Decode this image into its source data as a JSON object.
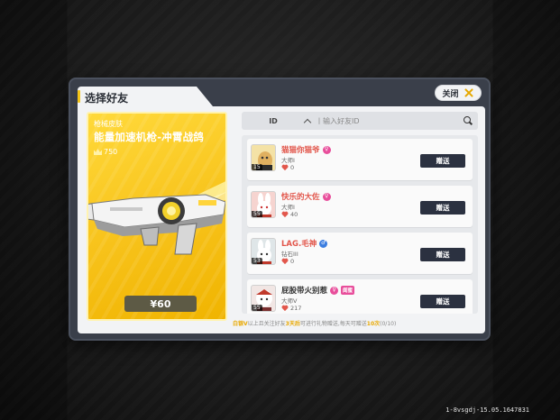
{
  "dialog": {
    "title": "选择好友",
    "close_label": "关闭"
  },
  "product": {
    "category": "枪械皮肤",
    "name": "能量加速机枪-冲霄战鸽",
    "points": "750",
    "price": "¥60"
  },
  "search": {
    "id_label": "ID",
    "placeholder": "丨输入好友ID"
  },
  "friends": [
    {
      "name": "猫猫你猫爷",
      "gender": "female",
      "gender_symbol": "♀",
      "rank": "大师I",
      "likes": "0",
      "level": "15",
      "tag": "",
      "gift_label": "赠送",
      "avatar_bg": "#f4e2a6"
    },
    {
      "name": "快乐的大佐",
      "gender": "female",
      "gender_symbol": "♀",
      "rank": "大师I",
      "likes": "40",
      "level": "55",
      "tag": "",
      "gift_label": "赠送",
      "avatar_bg": "#f6d4d0"
    },
    {
      "name": "LAG.毛神",
      "gender": "male",
      "gender_symbol": "♂",
      "rank": "钻石III",
      "likes": "0",
      "level": "53",
      "tag": "",
      "gift_label": "赠送",
      "avatar_bg": "#dfe6e8"
    },
    {
      "name": "屁股带火别惹",
      "gender": "female",
      "gender_symbol": "♀",
      "rank": "大师V",
      "likes": "217",
      "level": "55",
      "tag": "闺蜜",
      "gift_label": "赠送",
      "avatar_bg": "#f1e6e4"
    }
  ],
  "footer": {
    "prefix_highlight": "白银V",
    "part1": "以上且关注好友",
    "highlight_days": "3天后",
    "part2": "可进行礼物赠送,每天可赠送",
    "highlight_count": "10次",
    "suffix": "(0/10)"
  },
  "version": "1-8vsgdj-15.05.1647831",
  "colors": {
    "accent_yellow": "#f5c518",
    "card_yellow": "#f7c21a",
    "gift_button": "#2b3140",
    "name_red": "#e2574c",
    "highlight_orange": "#e8a800"
  }
}
